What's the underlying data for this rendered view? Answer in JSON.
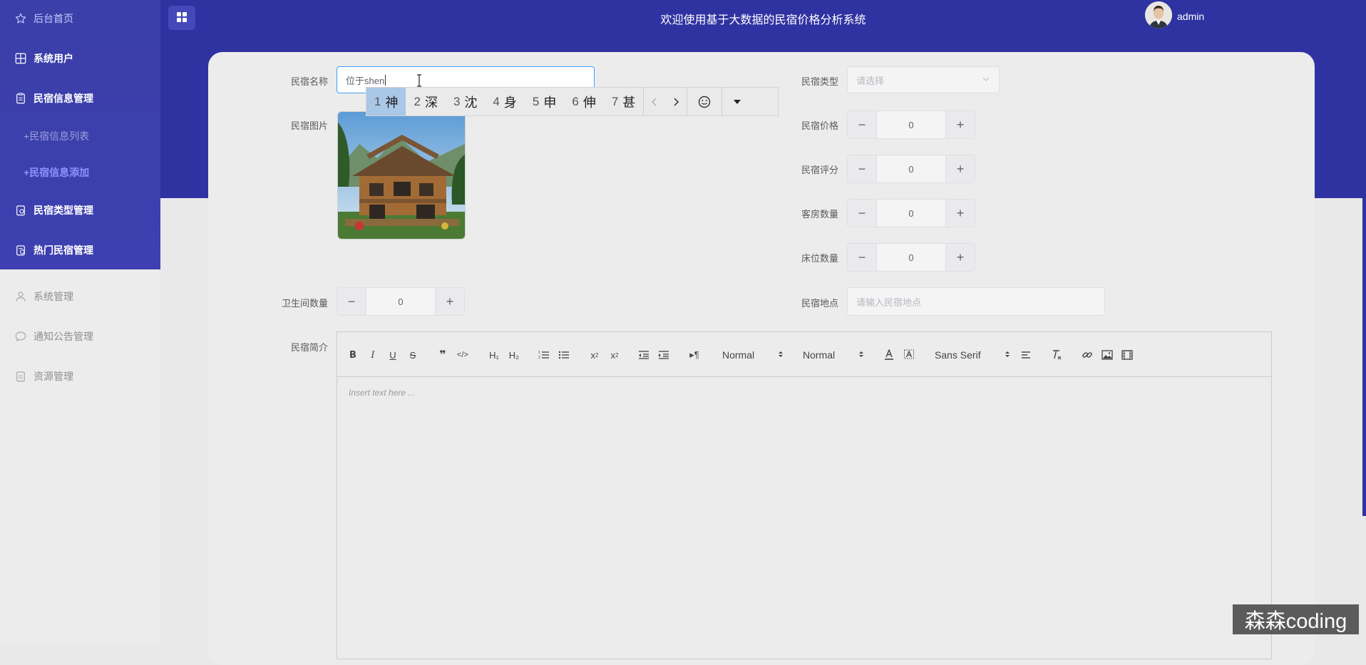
{
  "sidebar": {
    "items": [
      {
        "label": "后台首页",
        "icon": "star-icon"
      },
      {
        "label": "系统用户",
        "icon": "grid-icon"
      },
      {
        "label": "民宿信息管理",
        "icon": "clipboard-icon"
      },
      {
        "label": "民宿信息列表",
        "prefix": "+"
      },
      {
        "label": "民宿信息添加",
        "prefix": "+"
      },
      {
        "label": "民宿类型管理",
        "icon": "clipboard-icon"
      },
      {
        "label": "热门民宿管理",
        "icon": "clipboard-icon"
      },
      {
        "label": "系统管理",
        "icon": "user-icon"
      },
      {
        "label": "通知公告管理",
        "icon": "chat-icon"
      },
      {
        "label": "资源管理",
        "icon": "clipboard-icon"
      }
    ]
  },
  "header": {
    "title": "欢迎使用基于大数据的民宿价格分析系统",
    "user": "admin"
  },
  "form": {
    "name": {
      "label": "民宿名称",
      "value": "位于shen"
    },
    "type": {
      "label": "民宿类型",
      "placeholder": "请选择"
    },
    "image": {
      "label": "民宿图片"
    },
    "price": {
      "label": "民宿价格",
      "value": "0"
    },
    "rating": {
      "label": "民宿评分",
      "value": "0"
    },
    "rooms": {
      "label": "客房数量",
      "value": "0"
    },
    "beds": {
      "label": "床位数量",
      "value": "0"
    },
    "bathrooms": {
      "label": "卫生间数量",
      "value": "0"
    },
    "location": {
      "label": "民宿地点",
      "placeholder": "请输入民宿地点"
    },
    "intro": {
      "label": "民宿简介",
      "placeholder": "Insert text here ..."
    }
  },
  "ime": {
    "candidates": [
      {
        "num": "1",
        "char": "神"
      },
      {
        "num": "2",
        "char": "深"
      },
      {
        "num": "3",
        "char": "沈"
      },
      {
        "num": "4",
        "char": "身"
      },
      {
        "num": "5",
        "char": "申"
      },
      {
        "num": "6",
        "char": "伸"
      },
      {
        "num": "7",
        "char": "甚"
      }
    ]
  },
  "editor_toolbar": {
    "header_picker": "Normal",
    "size_picker": "Normal",
    "font_picker": "Sans Serif",
    "h1": "H₁",
    "h2": "H₂"
  },
  "steppers": {
    "minus": "−",
    "plus": "+"
  },
  "watermark": "森森coding",
  "colors": {
    "header": "#2f33a1",
    "sidebar": "#3d40b0",
    "accent": "#409eff"
  }
}
